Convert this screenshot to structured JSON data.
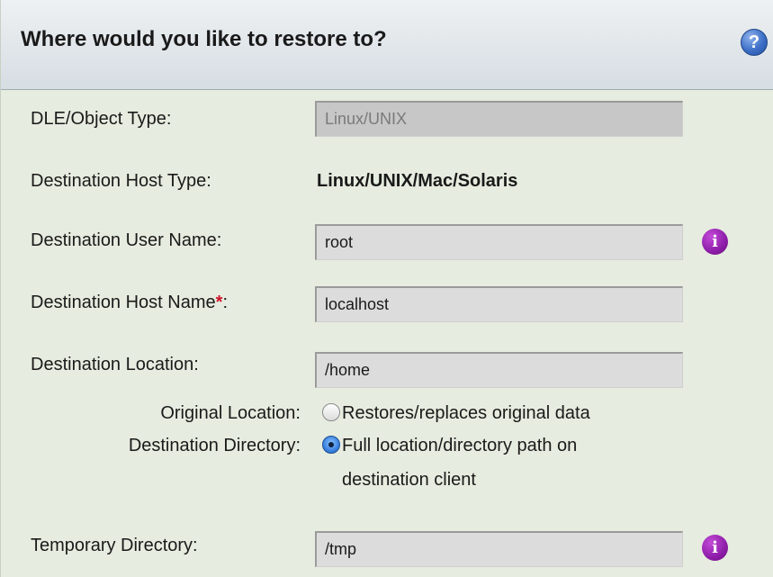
{
  "header": {
    "title": "Where would you like to restore to?",
    "help_glyph": "?"
  },
  "form": {
    "dle_type": {
      "label": "DLE/Object Type:",
      "value": "Linux/UNIX"
    },
    "host_type": {
      "label": "Destination Host Type:",
      "value": "Linux/UNIX/Mac/Solaris"
    },
    "user_name": {
      "label": "Destination User Name:",
      "value": "root"
    },
    "host_name": {
      "label": "Destination Host Name",
      "required_mark": "*",
      "label_suffix": ":",
      "value": "localhost"
    },
    "location": {
      "label": "Destination Location:",
      "value": "/home",
      "options": [
        {
          "label": "Original Location:",
          "text": "Restores/replaces original data",
          "checked": false
        },
        {
          "label": "Destination Directory:",
          "text_line1": "Full location/directory path on",
          "text_line2": "destination client",
          "checked": true
        }
      ]
    },
    "temp_dir": {
      "label": "Temporary Directory:",
      "value": "/tmp"
    }
  },
  "icons": {
    "info_glyph": "i",
    "info_color": "#8d1da8",
    "help_color": "#3d6fc7"
  }
}
